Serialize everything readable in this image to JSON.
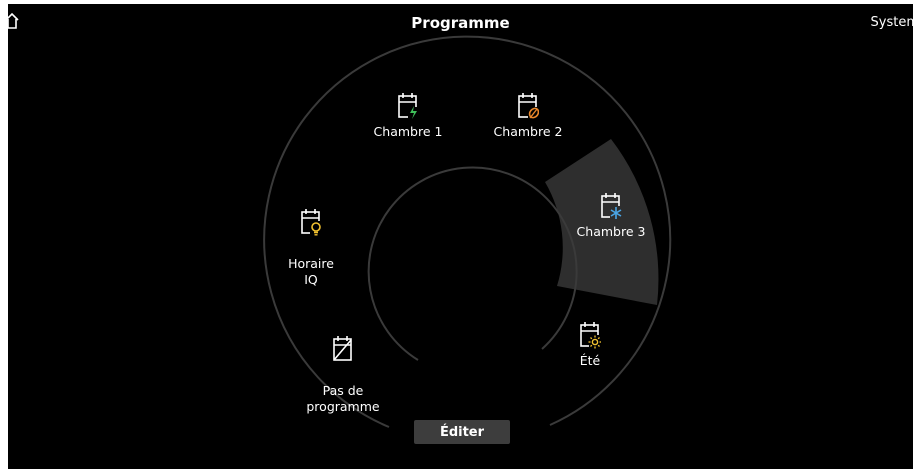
{
  "header": {
    "title": "Programme",
    "system_label": "System",
    "home_icon": "home-icon"
  },
  "programs": [
    {
      "label": "Chambre 1",
      "icon": "calendar-lightning-icon",
      "accent": "#3fbf5a"
    },
    {
      "label": "Chambre 2",
      "icon": "calendar-leaf-icon",
      "accent": "#e8862a"
    },
    {
      "label": "Chambre 3",
      "icon": "calendar-snowflake-icon",
      "accent": "#4aa6e6",
      "selected": true
    },
    {
      "label": "Été",
      "icon": "calendar-sun-icon",
      "accent": "#f2c230"
    },
    {
      "label": "Pas de\nprogramme",
      "icon": "calendar-off-icon",
      "accent": "#ffffff"
    },
    {
      "label": "Horaire\nIQ",
      "icon": "calendar-bulb-icon",
      "accent": "#f2c230"
    }
  ],
  "edit_button": {
    "label": "Éditer"
  },
  "colors": {
    "background": "#000000",
    "ring": "#3a3a3a",
    "selected_segment": "#2e2e2e",
    "button": "#3d3d3d"
  }
}
